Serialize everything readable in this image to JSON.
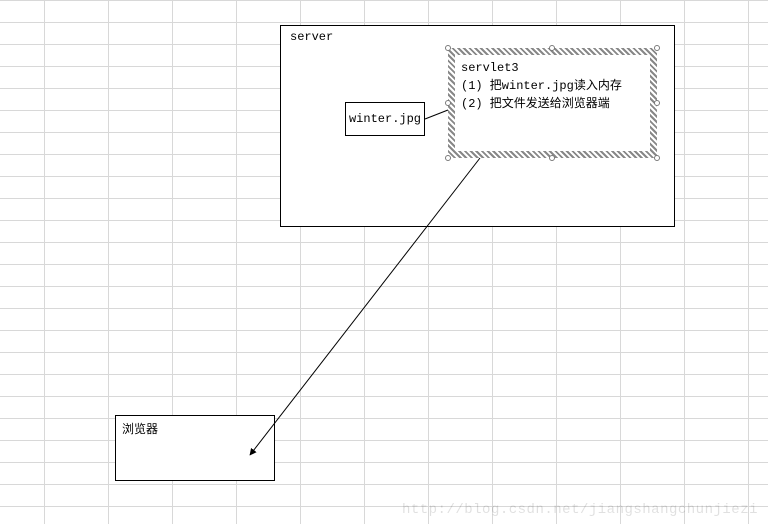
{
  "server": {
    "label": "server",
    "file_box": "winter.jpg",
    "servlet": {
      "title": "servlet3",
      "line1": "(1) 把winter.jpg读入内存",
      "line2": "(2) 把文件发送给浏览器端"
    }
  },
  "browser": {
    "label": "浏览器"
  },
  "watermark": "http://blog.csdn.net/jiangshangchunjiezi"
}
